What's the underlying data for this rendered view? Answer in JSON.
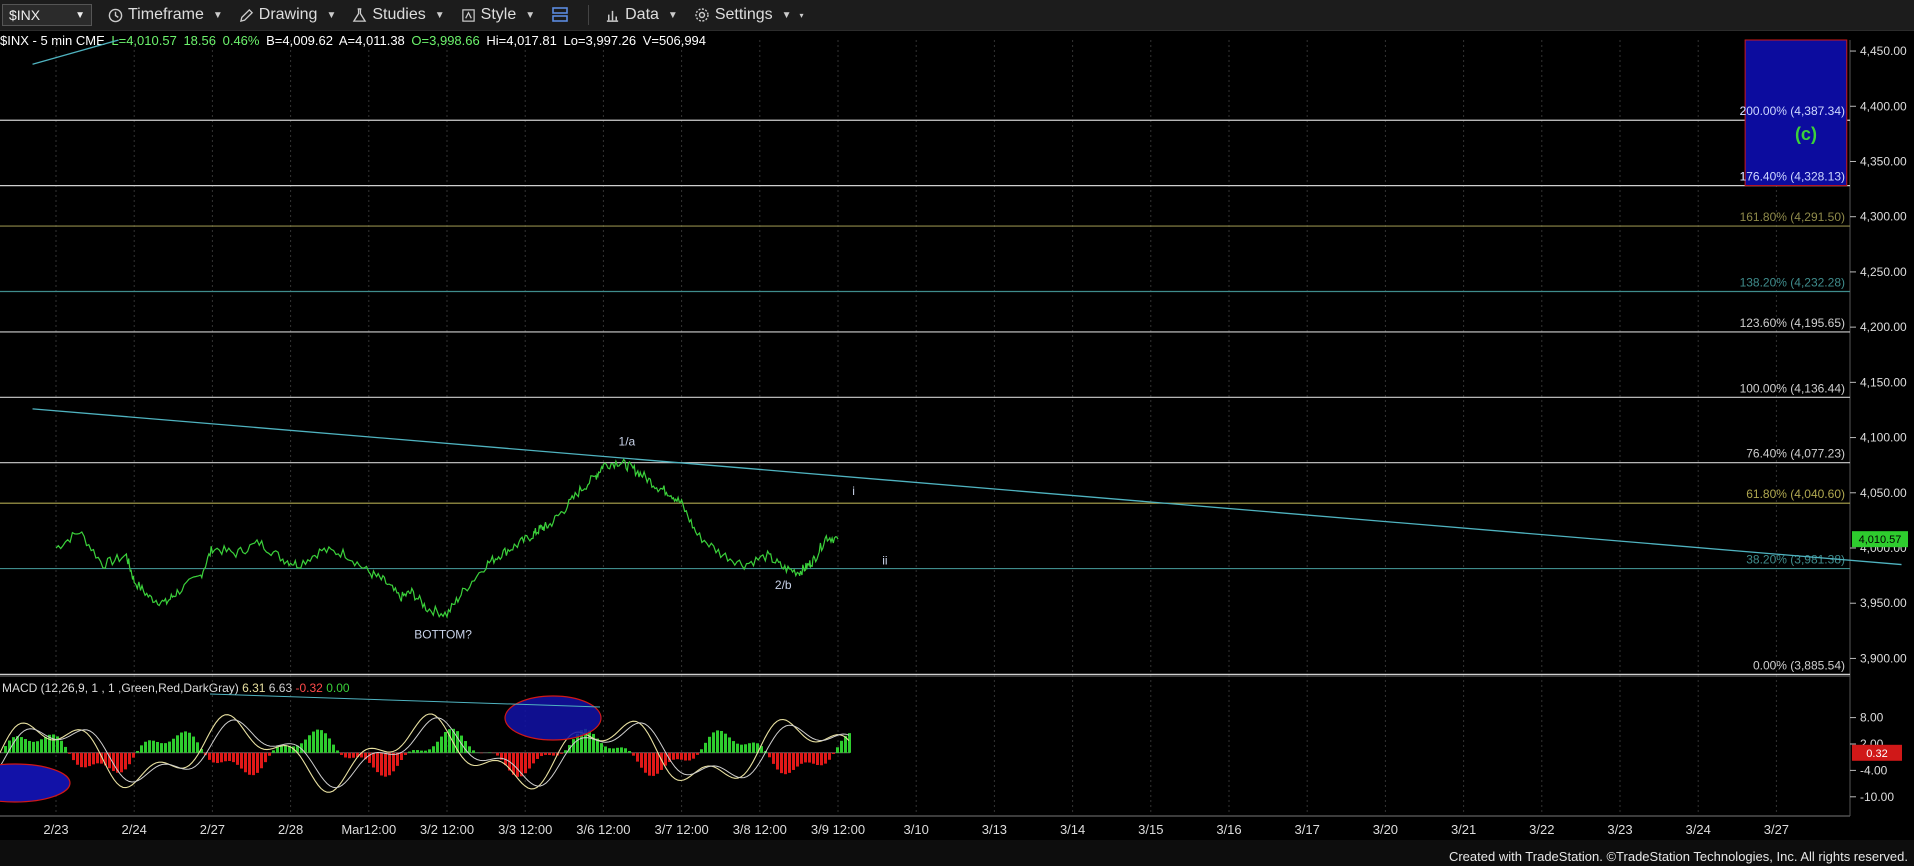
{
  "toolbar": {
    "symbol": "$INX",
    "timeframe": "Timeframe",
    "drawing": "Drawing",
    "studies": "Studies",
    "style": "Style",
    "data": "Data",
    "settings": "Settings"
  },
  "info": {
    "symbol_desc": "$INX - 5 min  CME",
    "last": "L=4,010.57",
    "change": "18.56",
    "pct": "0.46%",
    "bid": "B=4,009.62",
    "ask": "A=4,011.38",
    "open": "O=3,998.66",
    "high": "Hi=4,017.81",
    "low": "Lo=3,997.26",
    "volume": "V=506,994"
  },
  "macd": {
    "label": "MACD (12,26,9, 1 , 1 ,Green,Red,DarkGray)",
    "v1": "6.31",
    "v2": "6.63",
    "v3": "-0.32",
    "v4": "0.00",
    "axis_ticks": [
      "8.00",
      "2.00",
      "-4.00",
      "-10.00"
    ],
    "axis_values": [
      8,
      2,
      -4,
      -10
    ],
    "current_tag": "0.32"
  },
  "footer": "Created with TradeStation. ©TradeStation Technologies, Inc. All rights reserved.",
  "chart_data": {
    "type": "line",
    "ylim": [
      3885,
      4460
    ],
    "y_ticks": [
      4450,
      4400,
      4350,
      4300,
      4250,
      4200,
      4150,
      4100,
      4050,
      4000,
      3950,
      3900
    ],
    "y_tick_labels": [
      "4,450.00",
      "4,400.00",
      "4,350.00",
      "4,300.00",
      "4,250.00",
      "4,200.00",
      "4,150.00",
      "4,100.00",
      "4,050.00",
      "4,000.00",
      "3,950.00",
      "3,900.00"
    ],
    "x_labels": [
      "2/23",
      "2/24",
      "2/27",
      "2/28",
      "Mar12:00",
      "3/2 12:00",
      "3/3 12:00",
      "3/6 12:00",
      "3/7 12:00",
      "3/8 12:00",
      "3/9 12:00",
      "3/10",
      "3/13",
      "3/14",
      "3/15",
      "3/16",
      "3/17",
      "3/20",
      "3/21",
      "3/22",
      "3/23",
      "3/24",
      "3/27"
    ],
    "x_index": [
      0,
      1,
      2,
      3,
      4,
      5,
      6,
      7,
      8,
      9,
      10,
      11,
      12,
      13,
      14,
      15,
      16,
      17,
      18,
      19,
      20,
      21,
      22
    ],
    "last_price_tag": "4,010.57",
    "price_series": {
      "x": [
        0,
        0.3,
        0.6,
        0.9,
        1.0,
        1.2,
        1.4,
        1.55,
        1.85,
        2.0,
        2.3,
        2.6,
        2.9,
        3.1,
        3.4,
        3.7,
        4.0,
        4.2,
        4.4,
        4.55,
        4.75,
        5.0,
        5.2,
        5.5,
        5.7,
        5.9,
        6.1,
        6.2,
        6.3,
        6.5,
        6.7,
        6.9,
        7.0,
        7.2,
        7.35,
        7.5,
        7.7,
        7.85,
        8.0,
        8.2,
        8.5,
        8.8,
        9.1,
        9.3,
        9.5,
        9.6,
        9.7,
        9.85,
        10.0
      ],
      "y": [
        4000,
        4015,
        3985,
        3993,
        3970,
        3955,
        3950,
        3960,
        3975,
        4000,
        3995,
        4005,
        3990,
        3985,
        3998,
        3995,
        3978,
        3970,
        3955,
        3960,
        3945,
        3940,
        3960,
        3985,
        3995,
        4003,
        4012,
        4018,
        4020,
        4035,
        4052,
        4065,
        4075,
        4078,
        4073,
        4066,
        4055,
        4050,
        4040,
        4012,
        3995,
        3985,
        3993,
        3982,
        3978,
        3983,
        3990,
        4010,
        4008
      ]
    },
    "fib_levels": [
      {
        "pct": "200.00%",
        "value": 4387.34,
        "label": "200.00% (4,387.34)",
        "color": "#cfcfcf"
      },
      {
        "pct": "176.40%",
        "value": 4328.13,
        "label": "176.40% (4,328.13)",
        "color": "#cfcfcf"
      },
      {
        "pct": "161.80%",
        "value": 4291.5,
        "label": "161.80% (4,291.50)",
        "color": "#8f8a4a"
      },
      {
        "pct": "138.20%",
        "value": 4232.28,
        "label": "138.20% (4,232.28)",
        "color": "#3f8c8c"
      },
      {
        "pct": "123.60%",
        "value": 4195.65,
        "label": "123.60% (4,195.65)",
        "color": "#cfcfcf"
      },
      {
        "pct": "100.00%",
        "value": 4136.44,
        "label": "100.00% (4,136.44)",
        "color": "#cfcfcf"
      },
      {
        "pct": "76.40%",
        "value": 4077.23,
        "label": "76.40% (4,077.23)",
        "color": "#cfcfcf"
      },
      {
        "pct": "61.80%",
        "value": 4040.6,
        "label": "61.80% (4,040.60)",
        "color": "#b0a850"
      },
      {
        "pct": "38.20%",
        "value": 3981.38,
        "label": "38.20% (3,981.38)",
        "color": "#3f8c8c"
      },
      {
        "pct": "0.00%",
        "value": 3885.54,
        "label": "0.00% (3,885.54)",
        "color": "#cfcfcf"
      }
    ],
    "target_box": {
      "x_start": 21.6,
      "x_end": 22.9,
      "y_top": 4460,
      "y_bottom": 4328.13,
      "label": "(c)"
    },
    "trend_lines": [
      {
        "x1": -0.3,
        "y1": 4126,
        "x2": 23.6,
        "y2": 3985
      },
      {
        "x1": -0.3,
        "y1": 4438,
        "x2": 0.8,
        "y2": 4460
      }
    ],
    "annotations": [
      {
        "text": "1/a",
        "x": 7.3,
        "y": 4093
      },
      {
        "text": "BOTTOM?",
        "x": 4.95,
        "y": 3918
      },
      {
        "text": "2/b",
        "x": 9.3,
        "y": 3963
      },
      {
        "text": "i",
        "x": 10.2,
        "y": 4048
      },
      {
        "text": "ii",
        "x": 10.6,
        "y": 3985
      }
    ]
  }
}
